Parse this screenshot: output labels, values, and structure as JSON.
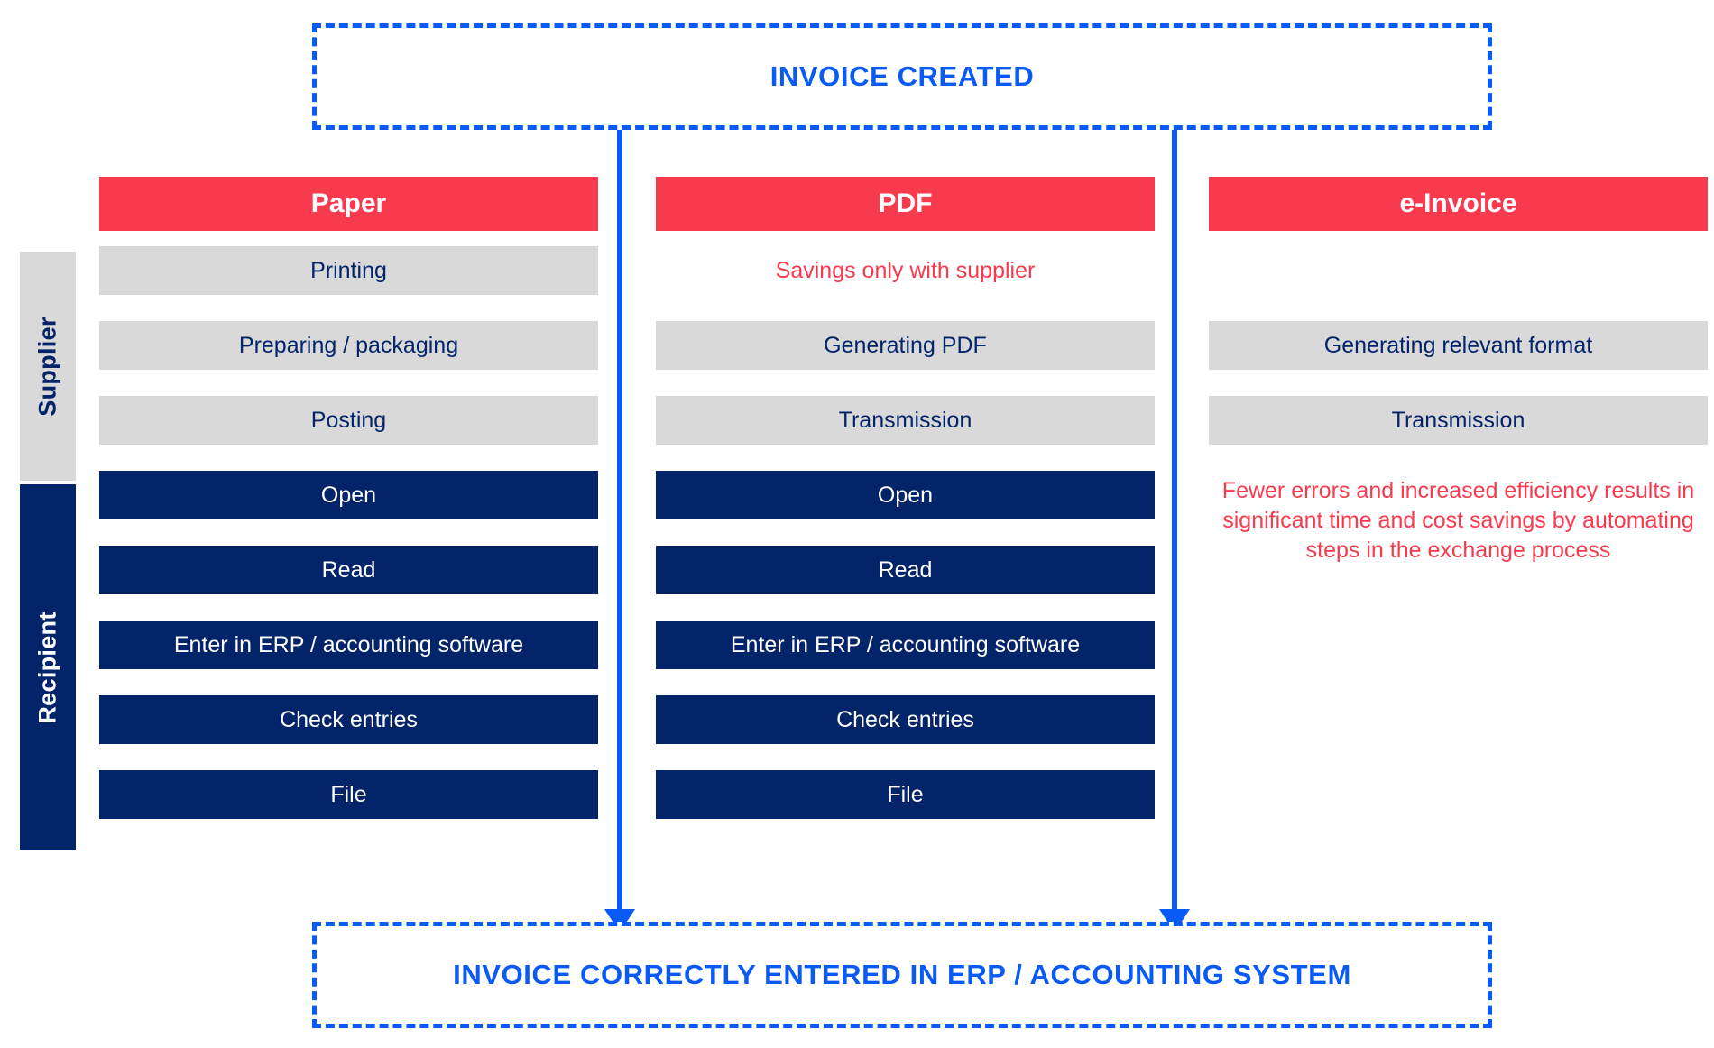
{
  "terminals": {
    "top": "INVOICE CREATED",
    "bottom": "INVOICE CORRECTLY ENTERED IN ERP / ACCOUNTING SYSTEM"
  },
  "lanes": {
    "supplier": "Supplier",
    "recipient": "Recipient"
  },
  "columns": {
    "paper": {
      "header": "Paper",
      "supplier_steps": [
        "Printing",
        "Preparing / packaging",
        "Posting"
      ],
      "recipient_steps": [
        "Open",
        "Read",
        "Enter in ERP / accounting software",
        "Check entries",
        "File"
      ]
    },
    "pdf": {
      "header": "PDF",
      "note": "Savings only with supplier",
      "supplier_steps": [
        "Generating PDF",
        "Transmission"
      ],
      "recipient_steps": [
        "Open",
        "Read",
        "Enter in ERP / accounting software",
        "Check entries",
        "File"
      ]
    },
    "einvoice": {
      "header": "e-Invoice",
      "supplier_steps": [
        "Generating relevant format",
        "Transmission"
      ],
      "benefit_note": "Fewer errors and increased efficiency results in significant time and cost savings by automating steps in the exchange process"
    }
  },
  "colors": {
    "accent_red": "#F73A4E",
    "navy": "#04246A",
    "gray": "#D9D9D9",
    "blue": "#0A5AF5"
  }
}
